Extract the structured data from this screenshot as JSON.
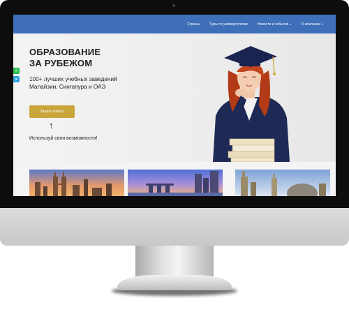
{
  "nav": {
    "items": [
      {
        "label": "Страны",
        "dropdown": false
      },
      {
        "label": "Туры по университетам",
        "dropdown": false
      },
      {
        "label": "Новости и события",
        "dropdown": true
      },
      {
        "label": "О компании",
        "dropdown": true
      }
    ]
  },
  "hero": {
    "title_line1": "ОБРАЗОВАНИЕ",
    "title_line2": "ЗА РУБЕЖОМ",
    "subtitle_line1": "100+ лучших учебных заведений",
    "subtitle_line2": "Малайзии, Сингапура и ОАЭ",
    "cta_label": "Задать вопрос",
    "arrow": "↑",
    "hint": "Используй свои возможности!"
  },
  "social": {
    "icons": [
      "whatsapp-icon",
      "telegram-icon"
    ]
  },
  "colors": {
    "nav": "#3e6fb8",
    "cta": "#c9a53a",
    "bezel": "#0d0d0d"
  }
}
